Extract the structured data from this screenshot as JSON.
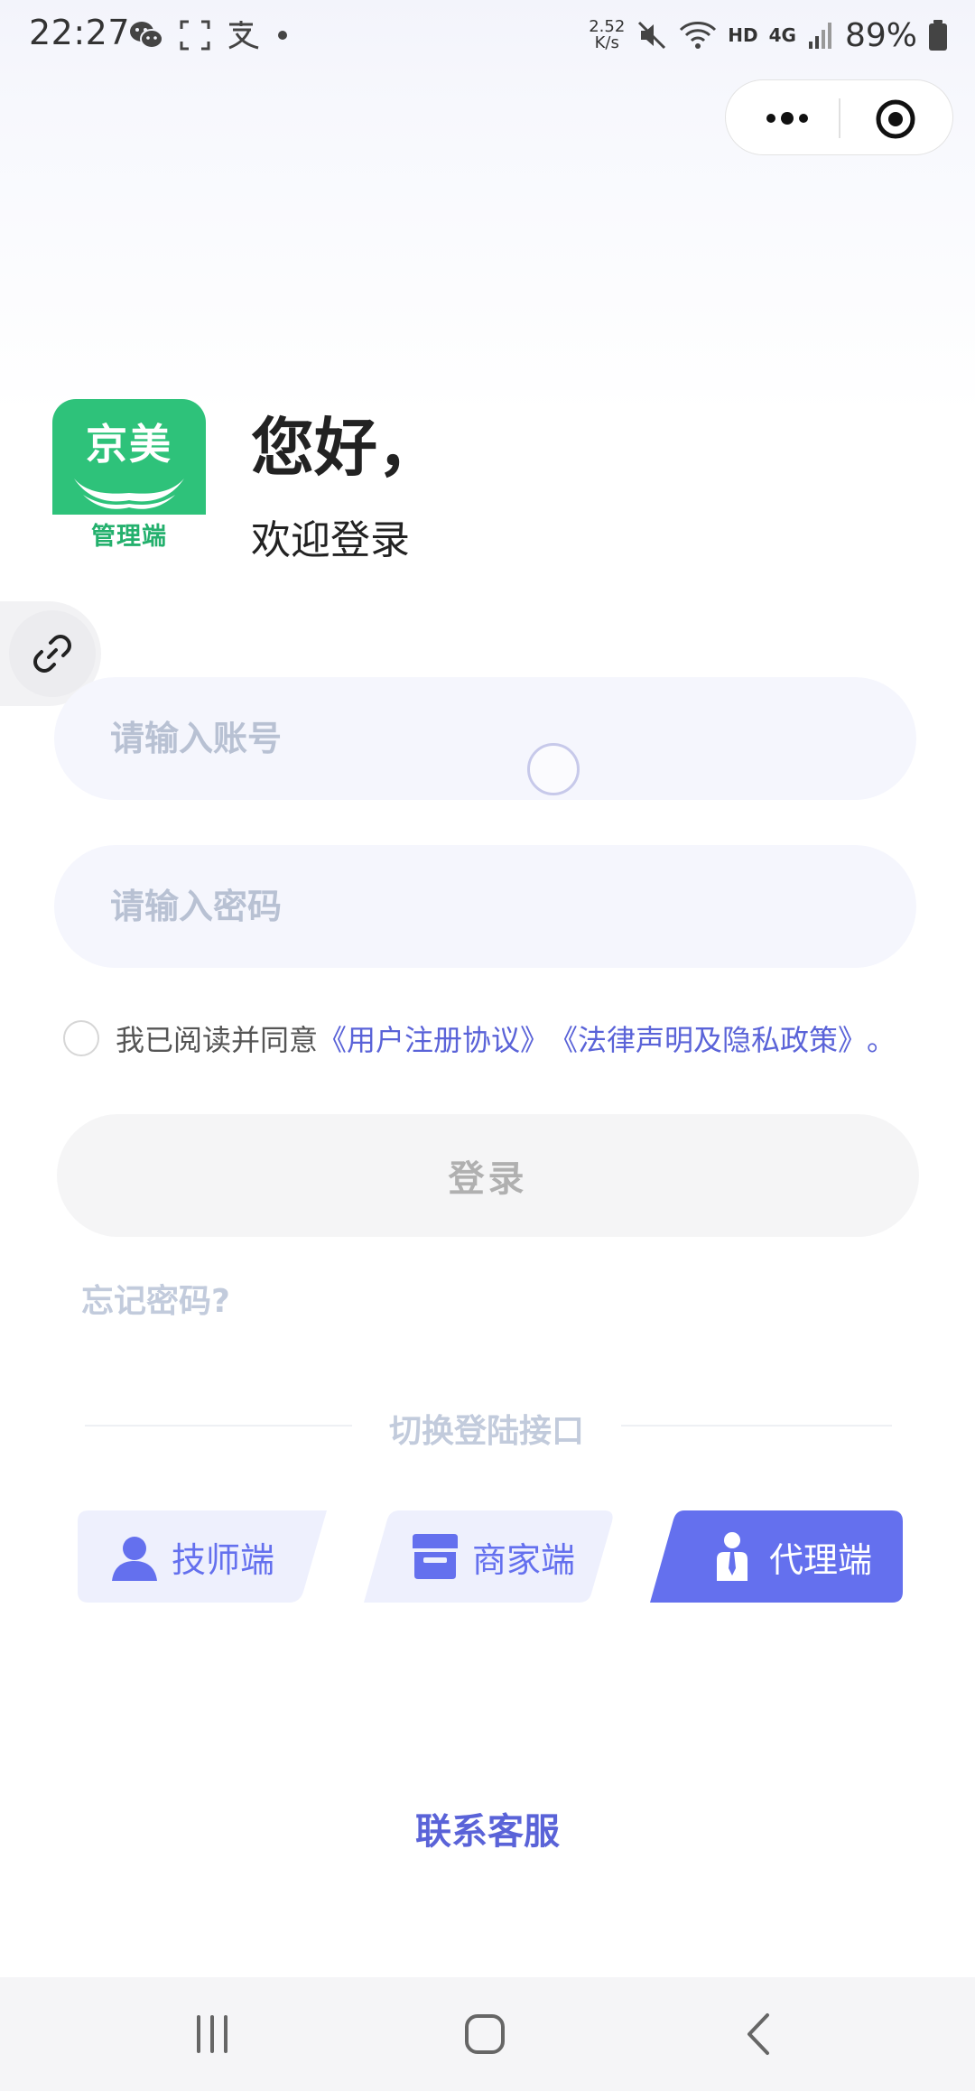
{
  "status_bar": {
    "time": "22:27",
    "net_speed_value": "2.52",
    "net_speed_unit": "K/s",
    "hd": "HD",
    "network": "4G",
    "battery": "89%"
  },
  "capsule": {
    "more_icon": "more-dots-icon",
    "close_icon": "target-circle-icon"
  },
  "header": {
    "logo_name": "京美",
    "logo_sub": "管理端",
    "greeting": "您好，",
    "welcome": "欢迎登录"
  },
  "form": {
    "account_placeholder": "请输入账号",
    "password_placeholder": "请输入密码",
    "agreement_prefix": "我已阅读并同意",
    "agreement_link_1": "《用户注册协议》",
    "agreement_link_2": "《法律声明及隐私政策》",
    "agreement_suffix": "。",
    "login_label": "登录",
    "forgot_label": "忘记密码?"
  },
  "switch": {
    "label": "切换登陆接口",
    "roles": [
      {
        "label": "技师端",
        "icon": "person-icon",
        "active": false
      },
      {
        "label": "商家端",
        "icon": "store-icon",
        "active": false
      },
      {
        "label": "代理端",
        "icon": "agent-icon",
        "active": true
      }
    ]
  },
  "contact_label": "联系客服",
  "colors": {
    "accent": "#6470ee",
    "link": "#5a63d8",
    "tab_bg": "#eef0fd",
    "brand_green": "#2ec27a",
    "placeholder": "#b8c1d3"
  }
}
